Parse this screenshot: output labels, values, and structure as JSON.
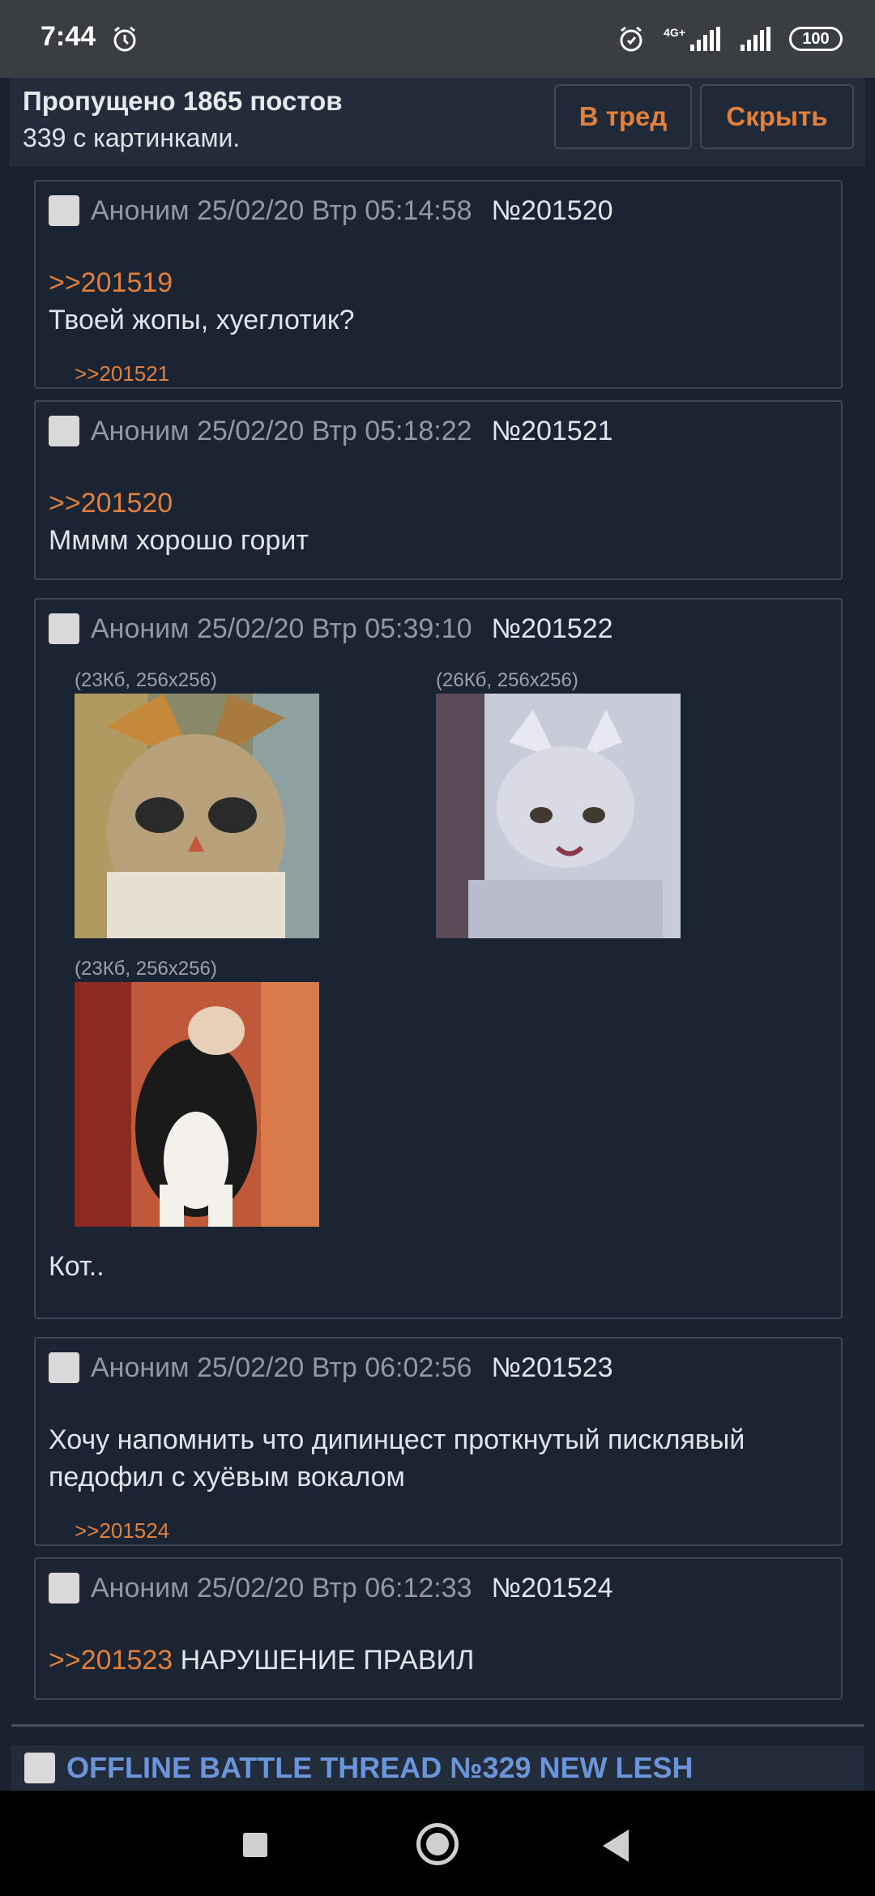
{
  "status_bar": {
    "time": "7:44",
    "network": "4G+",
    "battery": "100",
    "icons": [
      "alarm-icon",
      "signal-icon",
      "signal-icon",
      "battery-icon"
    ]
  },
  "header": {
    "skipped": "Пропущено 1865 постов",
    "with_images": "339 с картинками.",
    "to_thread_label": "В тред",
    "hide_label": "Скрыть"
  },
  "posts": [
    {
      "author": "Аноним 25/02/20 Втр 05:14:58",
      "number": "№201520",
      "reply_to": ">>201519",
      "text": "Твоей жопы, хуеглотик?",
      "backlink": ">>201521"
    },
    {
      "author": "Аноним 25/02/20 Втр 05:18:22",
      "number": "№201521",
      "reply_to": ">>201520",
      "text": "Мммм хорошо горит"
    },
    {
      "author": "Аноним 25/02/20 Втр 05:39:10",
      "number": "№201522",
      "images": [
        {
          "meta": "(23Кб, 256x256)"
        },
        {
          "meta": "(26Кб, 256x256)"
        },
        {
          "meta": "(23Кб, 256x256)"
        }
      ],
      "text": "Кот.."
    },
    {
      "author": "Аноним 25/02/20 Втр 06:02:56",
      "number": "№201523",
      "text_line1": "Хочу напомнить что дипинцест проткнутый писклявый",
      "text_line2": "педофил с хуёвым вокалом",
      "backlink": ">>201524"
    },
    {
      "author": "Аноним 25/02/20 Втр 06:12:33",
      "number": "№201524",
      "reply_to": ">>201523",
      "text": "НАРУШЕНИЕ ПРАВИЛ"
    }
  ],
  "next_thread": {
    "title": "OFFLINE BATTLE THREAD №329 NEW LESH"
  },
  "nav": {
    "icons": [
      "recents-square-icon",
      "home-circle-icon",
      "back-triangle-icon"
    ]
  },
  "colors": {
    "background": "#1a2230",
    "post_bg": "#1b2432",
    "link_orange": "#e0803c",
    "thread_title_blue": "#6b95d8"
  }
}
